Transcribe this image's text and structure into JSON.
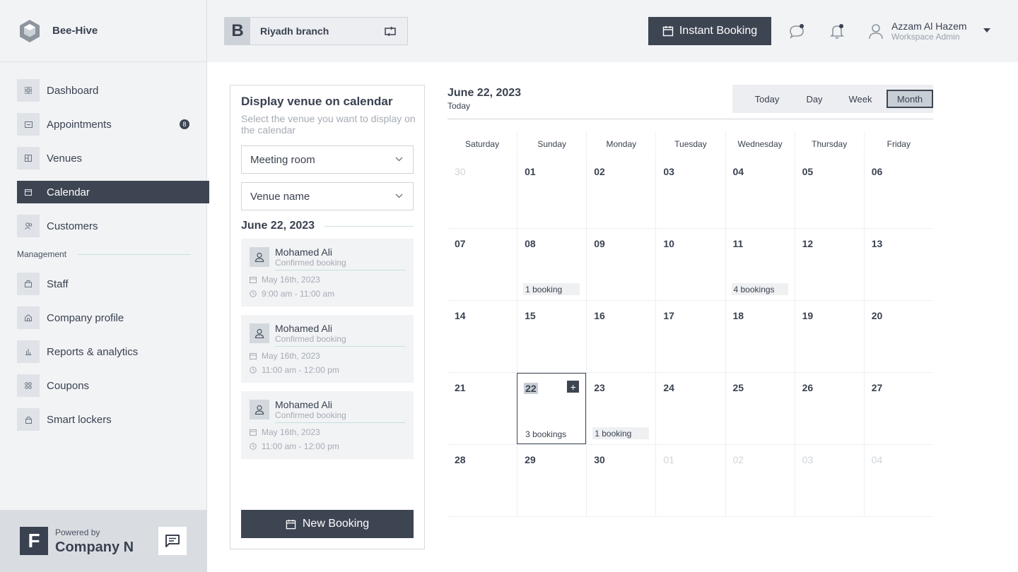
{
  "brand": {
    "name": "Bee-Hive"
  },
  "sidebar": {
    "items": [
      {
        "label": "Dashboard"
      },
      {
        "label": "Appointments",
        "badge": "8"
      },
      {
        "label": "Venues"
      },
      {
        "label": "Calendar"
      },
      {
        "label": "Customers"
      }
    ],
    "section_label": "Management",
    "management_items": [
      {
        "label": "Staff"
      },
      {
        "label": "Company profile"
      },
      {
        "label": "Reports & analytics"
      },
      {
        "label": "Coupons"
      },
      {
        "label": "Smart lockers"
      }
    ],
    "active_item": "Calendar"
  },
  "footer": {
    "powered_by": "Powered by",
    "company": "Company N",
    "logo_letter": "F"
  },
  "header": {
    "branch_letter": "B",
    "branch_name": "Riyadh branch",
    "instant_booking": "Instant Booking",
    "user_name": "Azzam Al Hazem",
    "user_role": "Workspace Admin"
  },
  "panel": {
    "title": "Display venue on calendar",
    "subtitle": "Select the venue you want to display on the calendar",
    "venue_type_value": "Meeting room",
    "venue_name_value": "Venue name",
    "date_heading": "June 22, 2023",
    "bookings": [
      {
        "name": "Mohamed Ali",
        "status": "Confirmed booking",
        "date": "May 16th, 2023",
        "time": "9:00 am - 11:00 am"
      },
      {
        "name": "Mohamed Ali",
        "status": "Confirmed booking",
        "date": "May 16th, 2023",
        "time": "11:00 am - 12:00 pm"
      },
      {
        "name": "Mohamed Ali",
        "status": "Confirmed booking",
        "date": "May 16th, 2023",
        "time": "11:00 am - 12:00 pm"
      }
    ],
    "new_booking": "New Booking"
  },
  "calendar": {
    "title": "June 22, 2023",
    "subtitle": "Today",
    "views": [
      "Today",
      "Day",
      "Week",
      "Month"
    ],
    "active_view": "Month",
    "weekdays": [
      "Saturday",
      "Sunday",
      "Monday",
      "Tuesday",
      "Wednesday",
      "Thursday",
      "Friday"
    ],
    "weeks": [
      [
        {
          "d": "30",
          "muted": true
        },
        {
          "d": "01"
        },
        {
          "d": "02"
        },
        {
          "d": "03"
        },
        {
          "d": "04"
        },
        {
          "d": "05"
        },
        {
          "d": "06"
        }
      ],
      [
        {
          "d": "07"
        },
        {
          "d": "08",
          "bookings": "1 booking"
        },
        {
          "d": "09"
        },
        {
          "d": "10"
        },
        {
          "d": "11",
          "bookings": "4 bookings"
        },
        {
          "d": "12"
        },
        {
          "d": "13"
        }
      ],
      [
        {
          "d": "14"
        },
        {
          "d": "15"
        },
        {
          "d": "16"
        },
        {
          "d": "17"
        },
        {
          "d": "18"
        },
        {
          "d": "19"
        },
        {
          "d": "20"
        }
      ],
      [
        {
          "d": "21"
        },
        {
          "d": "22",
          "bookings": "3 bookings",
          "selected": true
        },
        {
          "d": "23",
          "bookings": "1 booking"
        },
        {
          "d": "24"
        },
        {
          "d": "25"
        },
        {
          "d": "26"
        },
        {
          "d": "27"
        }
      ],
      [
        {
          "d": "28"
        },
        {
          "d": "29"
        },
        {
          "d": "30"
        },
        {
          "d": "01",
          "muted": true
        },
        {
          "d": "02",
          "muted": true
        },
        {
          "d": "03",
          "muted": true
        },
        {
          "d": "04",
          "muted": true
        }
      ]
    ]
  }
}
